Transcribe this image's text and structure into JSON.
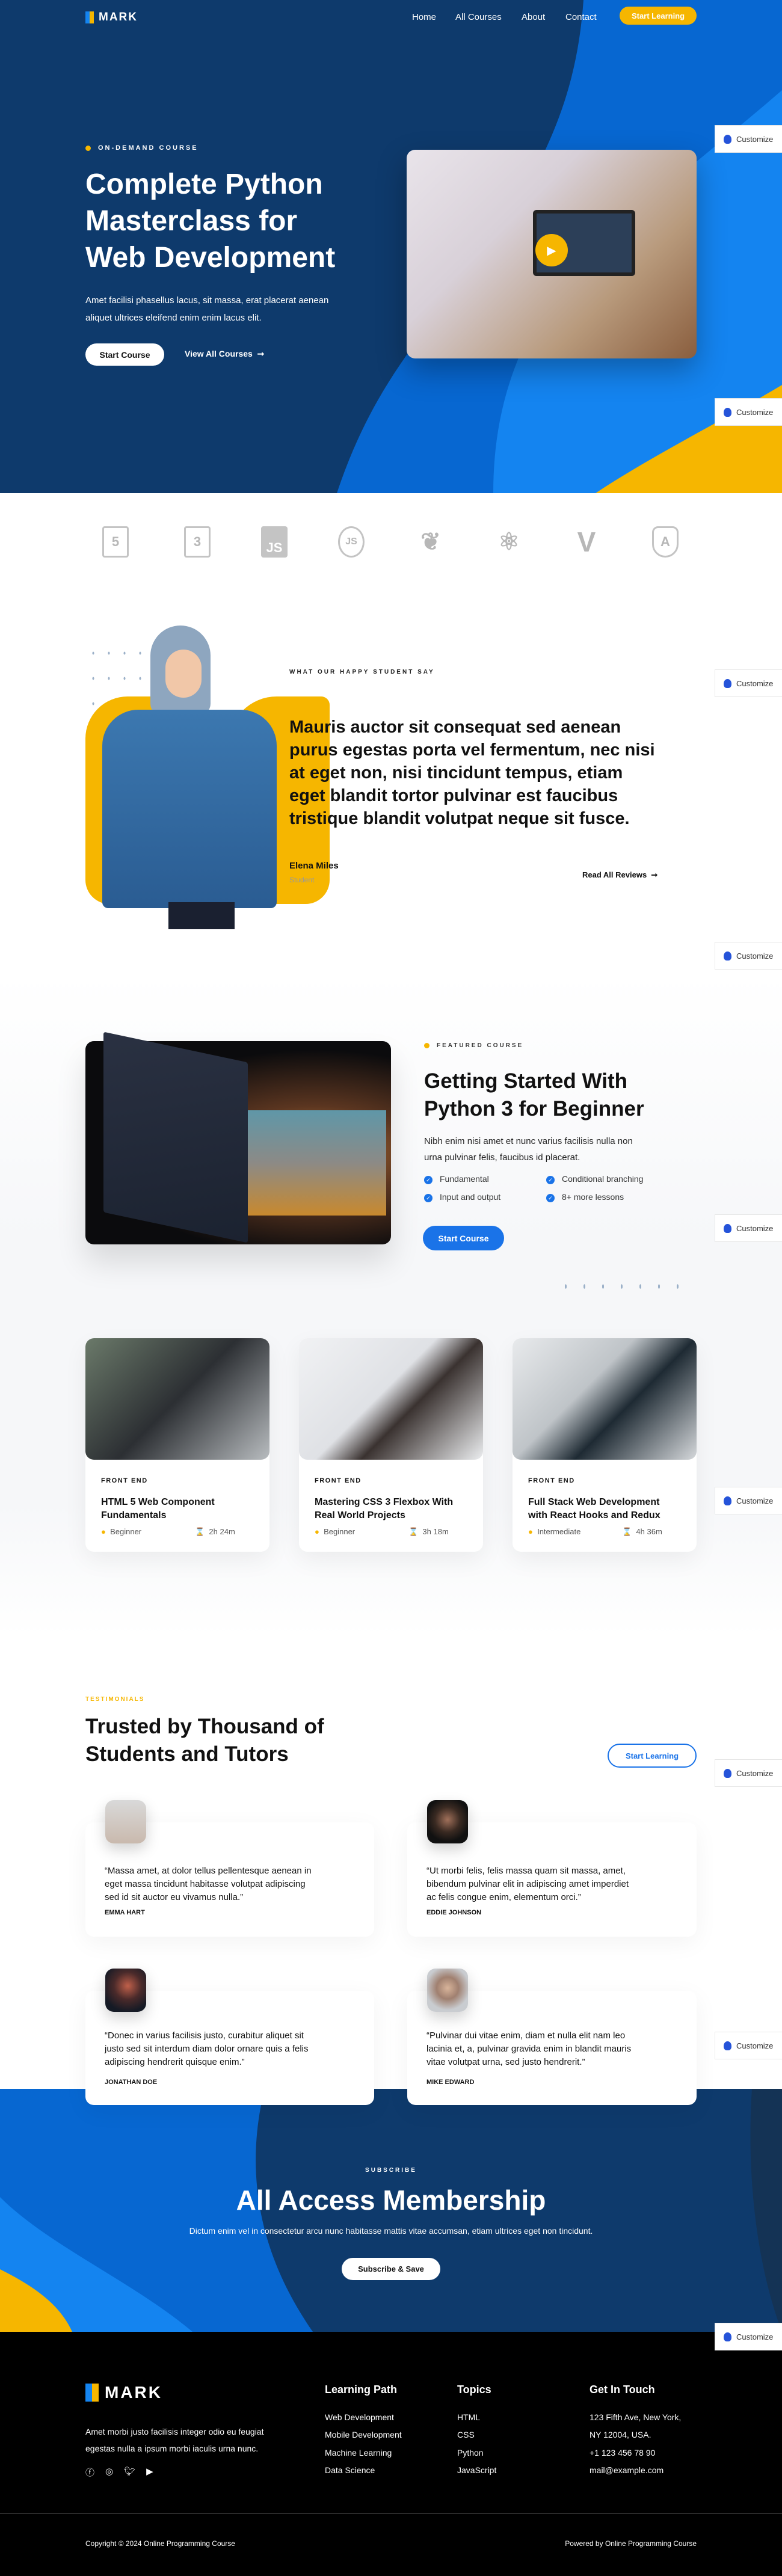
{
  "brand": {
    "name": "MARK"
  },
  "nav": {
    "items": [
      "Home",
      "All Courses",
      "About",
      "Contact"
    ],
    "cta": "Start Learning"
  },
  "hero": {
    "eyebrow": "ON-DEMAND COURSE",
    "title_lines": [
      "Complete Python",
      "Masterclass for",
      "Web Development"
    ],
    "description_lines": [
      "Amet facilisi phasellus lacus, sit massa, erat placerat aenean",
      "aliquet ultrices eleifend enim enim lacus elit."
    ],
    "primary_button": "Start Course",
    "secondary_button": "View All Courses",
    "secondary_icon": "arrow-right-icon",
    "video_icon": "play-icon"
  },
  "customize": {
    "label": "Customize",
    "icon": "palette-icon"
  },
  "tech_logos": [
    "html5",
    "css3",
    "js",
    "nodejs",
    "python",
    "react",
    "vue",
    "angular"
  ],
  "student_quote": {
    "eyebrow": "WHAT OUR HAPPY STUDENT SAY",
    "lines": [
      "Mauris auctor sit consequat sed aenean",
      "purus egestas porta vel fermentum, nec nisi",
      "at eget non, nisi tincidunt tempus, etiam",
      "eget blandit tortor pulvinar est faucibus",
      "tristique blandit volutpat neque sit fusce."
    ],
    "name": "Elena Miles",
    "role": "Student",
    "link": "Read All Reviews"
  },
  "featured": {
    "eyebrow": "FEATURED COURSE",
    "title_lines": [
      "Getting Started With",
      "Python 3 for Beginner"
    ],
    "description_lines": [
      "Nibh enim nisi amet et nunc varius facilisis nulla non",
      "urna pulvinar felis, faucibus id placerat."
    ],
    "checklist": [
      "Fundamental",
      "Conditional branching",
      "Input and output",
      "8+ more lessons"
    ],
    "button": "Start Course"
  },
  "courses": [
    {
      "category": "FRONT END",
      "title_lines": [
        "HTML 5 Web Component",
        "Fundamentals"
      ],
      "level": "Beginner",
      "duration": "2h 24m"
    },
    {
      "category": "FRONT END",
      "title_lines": [
        "Mastering CSS 3 Flexbox With",
        "Real World Projects"
      ],
      "level": "Beginner",
      "duration": "3h 18m"
    },
    {
      "category": "FRONT END",
      "title_lines": [
        "Full Stack Web Development",
        "with React Hooks and Redux"
      ],
      "level": "Intermediate",
      "duration": "4h 36m"
    }
  ],
  "testimonials": {
    "eyebrow": "TESTIMONIALS",
    "title_lines": [
      "Trusted by Thousand of",
      "Students and Tutors"
    ],
    "button": "Start Learning",
    "items": [
      {
        "lines": [
          "“Massa amet, at dolor tellus pellentesque aenean in",
          "eget massa tincidunt habitasse volutpat adipiscing",
          "sed id sit auctor eu vivamus nulla.”"
        ],
        "name": "EMMA HART"
      },
      {
        "lines": [
          "“Ut morbi felis, felis massa quam sit massa, amet,",
          "bibendum pulvinar elit in adipiscing amet imperdiet",
          "ac felis congue enim, elementum orci.”"
        ],
        "name": "EDDIE JOHNSON"
      },
      {
        "lines": [
          "“Donec in varius facilisis justo, curabitur aliquet sit",
          "justo sed sit interdum diam dolor ornare quis a felis",
          "adipiscing hendrerit quisque enim.”"
        ],
        "name": "JONATHAN DOE"
      },
      {
        "lines": [
          "“Pulvinar dui vitae enim, diam et nulla elit nam leo",
          "lacinia et, a, pulvinar gravida enim in blandit mauris",
          "vitae volutpat urna, sed justo hendrerit.”"
        ],
        "name": "MIKE EDWARD"
      }
    ]
  },
  "membership": {
    "eyebrow": "SUBSCRIBE",
    "title": "All Access Membership",
    "description": "Dictum enim vel in consectetur arcu nunc habitasse mattis vitae accumsan, etiam ultrices eget non tincidunt.",
    "button": "Subscribe & Save"
  },
  "footer": {
    "description_lines": [
      "Amet morbi justo facilisis integer odio eu feugiat",
      "egestas nulla a ipsum morbi iaculis urna nunc."
    ],
    "social": [
      "facebook-icon",
      "instagram-icon",
      "twitter-icon",
      "youtube-icon"
    ],
    "columns": [
      {
        "title": "Learning Path",
        "links": [
          "Web Development",
          "Mobile Development",
          "Machine Learning",
          "Data Science"
        ]
      },
      {
        "title": "Topics",
        "links": [
          "HTML",
          "CSS",
          "Python",
          "JavaScript"
        ]
      },
      {
        "title": "Get In Touch",
        "links": [
          "123 Fifth Ave, New York,",
          "NY 12004, USA.",
          "+1 123 456 78 90",
          "mail@example.com"
        ]
      }
    ],
    "copyright": "Copyright © 2024 Online Programming Course",
    "powered": "Powered by Online Programming Course"
  },
  "colors": {
    "navy": "#0e3a6c",
    "blue": "#0767d1",
    "light_blue": "#1484f0",
    "yellow": "#f6b600",
    "accent_button": "#1a73e8"
  }
}
